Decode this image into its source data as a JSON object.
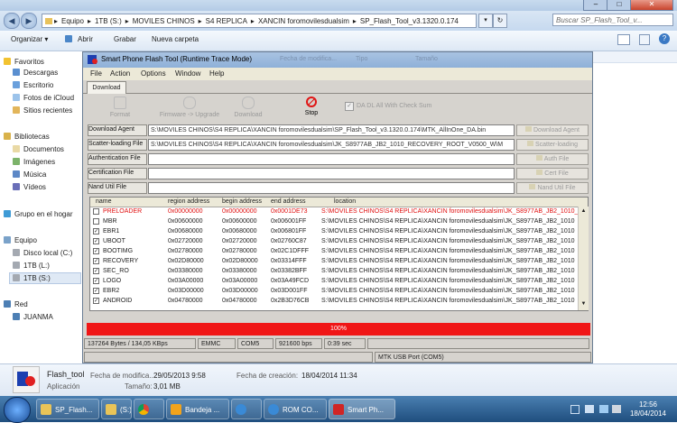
{
  "explorer": {
    "path": [
      "Equipo",
      "1TB (S:)",
      "MOVILES CHINOS",
      "S4 REPLICA",
      "XANCIN foromovilesdualsim",
      "SP_Flash_Tool_v3.1320.0.174"
    ],
    "path_sep": "▸",
    "search_placeholder": "Buscar SP_Flash_Tool_v...",
    "commands": [
      "Organizar ▾",
      "Abrir",
      "Grabar",
      "Nueva carpeta"
    ],
    "nav": {
      "favoritos": "Favoritos",
      "fav_items": [
        "Descargas",
        "Escritorio",
        "Fotos de iCloud",
        "Sitios recientes"
      ],
      "bibliotecas": "Bibliotecas",
      "lib_items": [
        "Documentos",
        "Imágenes",
        "Música",
        "Vídeos"
      ],
      "grupo": "Grupo en el hogar",
      "equipo": "Equipo",
      "eq_items": [
        "Disco local (C:)",
        "1TB (L:)",
        "1TB (S:)"
      ],
      "red": "Red",
      "red_items": [
        "JUANMA"
      ]
    },
    "details": {
      "name": "Flash_tool",
      "type": "Aplicación",
      "modified_label": "Fecha de modifica...:",
      "modified": "29/05/2013 9:58",
      "created_label": "Fecha de creación:",
      "created": "18/04/2014 11:34",
      "size_label": "Tamaño:",
      "size": "3,01 MB"
    }
  },
  "taskbar": {
    "items": [
      "SP_Flash...",
      "(S:)",
      "",
      "Bandeja ...",
      "",
      "ROM CO...",
      "Smart Ph..."
    ],
    "time": "12:56",
    "date": "18/04/2014"
  },
  "flash": {
    "title": "Smart Phone Flash Tool (Runtime Trace Mode)",
    "menu": [
      "File",
      "Action",
      "Options",
      "Window",
      "Help"
    ],
    "tab": "Download",
    "toolbar": {
      "format": "Format",
      "fw_upgrade": "Firmware -> Upgrade",
      "download": "Download",
      "stop": "Stop",
      "da_check": "DA DL All With Check Sum"
    },
    "fields": [
      {
        "label": "Download Agent",
        "value": "S:\\MOVILES CHINOS\\S4 REPLICA\\XANCIN foromovilesdualsim\\SP_Flash_Tool_v3.1320.0.174\\MTK_AllInOne_DA.bin",
        "button": "Download Agent"
      },
      {
        "label": "Scatter-loading File",
        "value": "S:\\MOVILES CHINOS\\S4 REPLICA\\XANCIN foromovilesdualsim\\JK_S8977AB_JB2_1010_RECOVERY_ROOT_V0500_W\\M",
        "button": "Scatter-loading"
      },
      {
        "label": "Authentication File",
        "value": "",
        "button": "Auth File"
      },
      {
        "label": "Certification File",
        "value": "",
        "button": "Cert File"
      },
      {
        "label": "Nand Util File",
        "value": "",
        "button": "Nand Util File"
      }
    ],
    "columns": [
      "name",
      "region address",
      "begin address",
      "end address",
      "location"
    ],
    "rows": [
      {
        "name": "PRELOADER",
        "region": "0x00000000",
        "begin": "0x00000000",
        "end": "0x0001DE73",
        "loc": "S:\\MOVILES CHINOS\\S4 REPLICA\\XANCIN foromovilesdualsim\\JK_S8977AB_JB2_1010_RECOVERY",
        "checked": false,
        "red": true
      },
      {
        "name": "MBR",
        "region": "0x00600000",
        "begin": "0x00600000",
        "end": "0x006001FF",
        "loc": "S:\\MOVILES CHINOS\\S4 REPLICA\\XANCIN foromovilesdualsim\\JK_S8977AB_JB2_1010",
        "checked": false,
        "red": false
      },
      {
        "name": "EBR1",
        "region": "0x00680000",
        "begin": "0x00680000",
        "end": "0x006801FF",
        "loc": "S:\\MOVILES CHINOS\\S4 REPLICA\\XANCIN foromovilesdualsim\\JK_S8977AB_JB2_1010",
        "checked": true,
        "red": false
      },
      {
        "name": "UBOOT",
        "region": "0x02720000",
        "begin": "0x02720000",
        "end": "0x02760C87",
        "loc": "S:\\MOVILES CHINOS\\S4 REPLICA\\XANCIN foromovilesdualsim\\JK_S8977AB_JB2_1010",
        "checked": true,
        "red": false
      },
      {
        "name": "BOOTIMG",
        "region": "0x02780000",
        "begin": "0x02780000",
        "end": "0x02C1DFFF",
        "loc": "S:\\MOVILES CHINOS\\S4 REPLICA\\XANCIN foromovilesdualsim\\JK_S8977AB_JB2_1010",
        "checked": true,
        "red": false
      },
      {
        "name": "RECOVERY",
        "region": "0x02D80000",
        "begin": "0x02D80000",
        "end": "0x03314FFF",
        "loc": "S:\\MOVILES CHINOS\\S4 REPLICA\\XANCIN foromovilesdualsim\\JK_S8977AB_JB2_1010",
        "checked": true,
        "red": false
      },
      {
        "name": "SEC_RO",
        "region": "0x03380000",
        "begin": "0x03380000",
        "end": "0x03382BFF",
        "loc": "S:\\MOVILES CHINOS\\S4 REPLICA\\XANCIN foromovilesdualsim\\JK_S8977AB_JB2_1010",
        "checked": true,
        "red": false
      },
      {
        "name": "LOGO",
        "region": "0x03A00000",
        "begin": "0x03A00000",
        "end": "0x03A49FCD",
        "loc": "S:\\MOVILES CHINOS\\S4 REPLICA\\XANCIN foromovilesdualsim\\JK_S8977AB_JB2_1010",
        "checked": true,
        "red": false
      },
      {
        "name": "EBR2",
        "region": "0x03D00000",
        "begin": "0x03D00000",
        "end": "0x03D001FF",
        "loc": "S:\\MOVILES CHINOS\\S4 REPLICA\\XANCIN foromovilesdualsim\\JK_S8977AB_JB2_1010",
        "checked": true,
        "red": false
      },
      {
        "name": "ANDROID",
        "region": "0x04780000",
        "begin": "0x04780000",
        "end": "0x2B3D76CB",
        "loc": "S:\\MOVILES CHINOS\\S4 REPLICA\\XANCIN foromovilesdualsim\\JK_S8977AB_JB2_1010",
        "checked": true,
        "red": false
      }
    ],
    "progress_text": "100%",
    "status": [
      "137264 Bytes / 134,05 KBps",
      "EMMC",
      "COM5",
      "921600 bps",
      "0:39 sec"
    ],
    "usb_port": "MTK USB Port (COM5)",
    "ghost_text": [
      "Fecha de modifica...",
      "Tipo",
      "Tamaño"
    ]
  },
  "colors": {
    "progress_red": "#f01616",
    "preloader_red": "#e01010"
  }
}
